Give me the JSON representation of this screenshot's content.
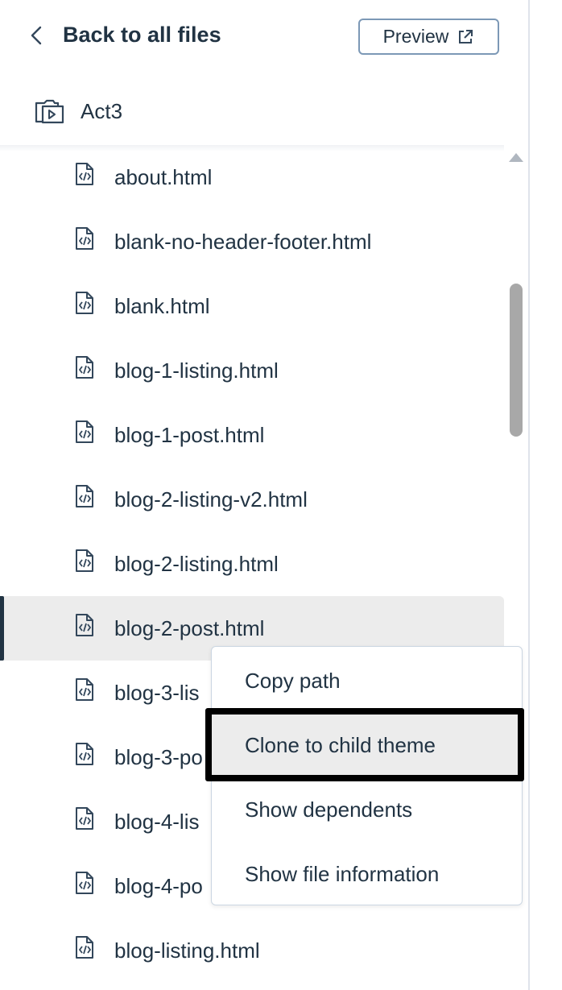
{
  "header": {
    "back_label": "Back to all files",
    "preview_label": "Preview"
  },
  "theme": {
    "name": "Act3"
  },
  "files": [
    {
      "name": "about.html"
    },
    {
      "name": "blank-no-header-footer.html"
    },
    {
      "name": "blank.html"
    },
    {
      "name": "blog-1-listing.html"
    },
    {
      "name": "blog-1-post.html"
    },
    {
      "name": "blog-2-listing-v2.html"
    },
    {
      "name": "blog-2-listing.html"
    },
    {
      "name": "blog-2-post.html",
      "selected": true
    },
    {
      "name": "blog-3-lis"
    },
    {
      "name": "blog-3-po"
    },
    {
      "name": "blog-4-lis"
    },
    {
      "name": "blog-4-po"
    },
    {
      "name": "blog-listing.html"
    }
  ],
  "context_menu": {
    "items": [
      {
        "label": "Copy path"
      },
      {
        "label": "Clone to child theme",
        "highlighted": true
      },
      {
        "label": "Show dependents"
      },
      {
        "label": "Show file information"
      }
    ]
  },
  "colors": {
    "text": "#213343",
    "selected_row": "#ececec",
    "focus_outline": "#000000"
  }
}
